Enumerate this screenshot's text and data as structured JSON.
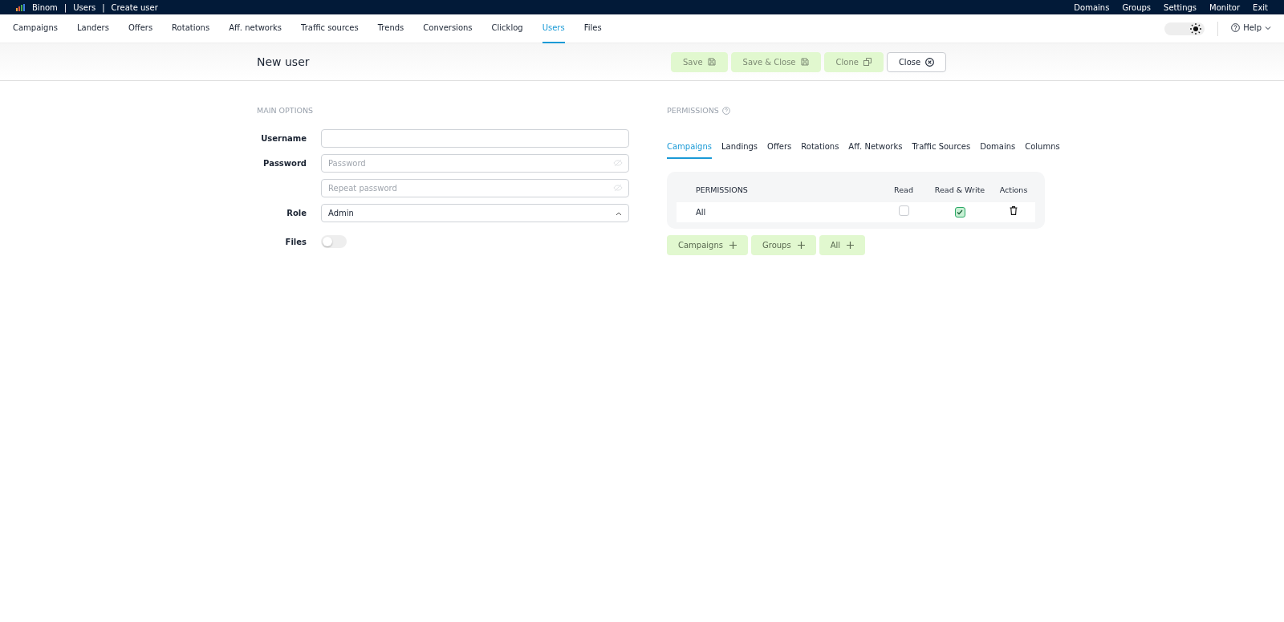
{
  "breadcrumb": [
    "Binom",
    "Users",
    "Create user"
  ],
  "breadcrumb_separator": "|",
  "top_links": [
    "Domains",
    "Groups",
    "Settings",
    "Monitor",
    "Exit"
  ],
  "nav": [
    {
      "label": "Campaigns",
      "selected": false
    },
    {
      "label": "Landers",
      "selected": false
    },
    {
      "label": "Offers",
      "selected": false
    },
    {
      "label": "Rotations",
      "selected": false
    },
    {
      "label": "Aff. networks",
      "selected": false
    },
    {
      "label": "Traffic sources",
      "selected": false
    },
    {
      "label": "Trends",
      "selected": false
    },
    {
      "label": "Conversions",
      "selected": false
    },
    {
      "label": "Clicklog",
      "selected": false
    },
    {
      "label": "Users",
      "selected": true
    },
    {
      "label": "Files",
      "selected": false
    }
  ],
  "help": "Help",
  "page_title": "New user",
  "actions": [
    {
      "label": "Save",
      "kind": "save",
      "disabled": true
    },
    {
      "label": "Save & Close",
      "kind": "save",
      "disabled": true
    },
    {
      "label": "Clone",
      "kind": "clone",
      "disabled": true
    },
    {
      "label": "Close",
      "kind": "close",
      "disabled": false
    }
  ],
  "main_options": {
    "heading": "MAIN OPTIONS",
    "username": {
      "label": "Username"
    },
    "password": {
      "label": "Password",
      "placeholder": "Password",
      "repeat_placeholder": "Repeat password"
    },
    "role": {
      "label": "Role",
      "value": "Admin"
    },
    "files": {
      "label": "Files",
      "on": false
    }
  },
  "permissions": {
    "heading": "PERMISSIONS",
    "tabs": [
      {
        "label": "Campaigns",
        "selected": true
      },
      {
        "label": "Landings",
        "selected": false
      },
      {
        "label": "Offers",
        "selected": false
      },
      {
        "label": "Rotations",
        "selected": false
      },
      {
        "label": "Aff. Networks",
        "selected": false
      },
      {
        "label": "Traffic Sources",
        "selected": false
      },
      {
        "label": "Domains",
        "selected": false
      },
      {
        "label": "Columns",
        "selected": false
      }
    ],
    "columns": [
      "PERMISSIONS",
      "Read",
      "Read & Write",
      "Actions"
    ],
    "rows": [
      {
        "name": "All",
        "read": false,
        "read_write": true
      }
    ],
    "add_buttons": [
      "Campaigns",
      "Groups",
      "All"
    ]
  }
}
